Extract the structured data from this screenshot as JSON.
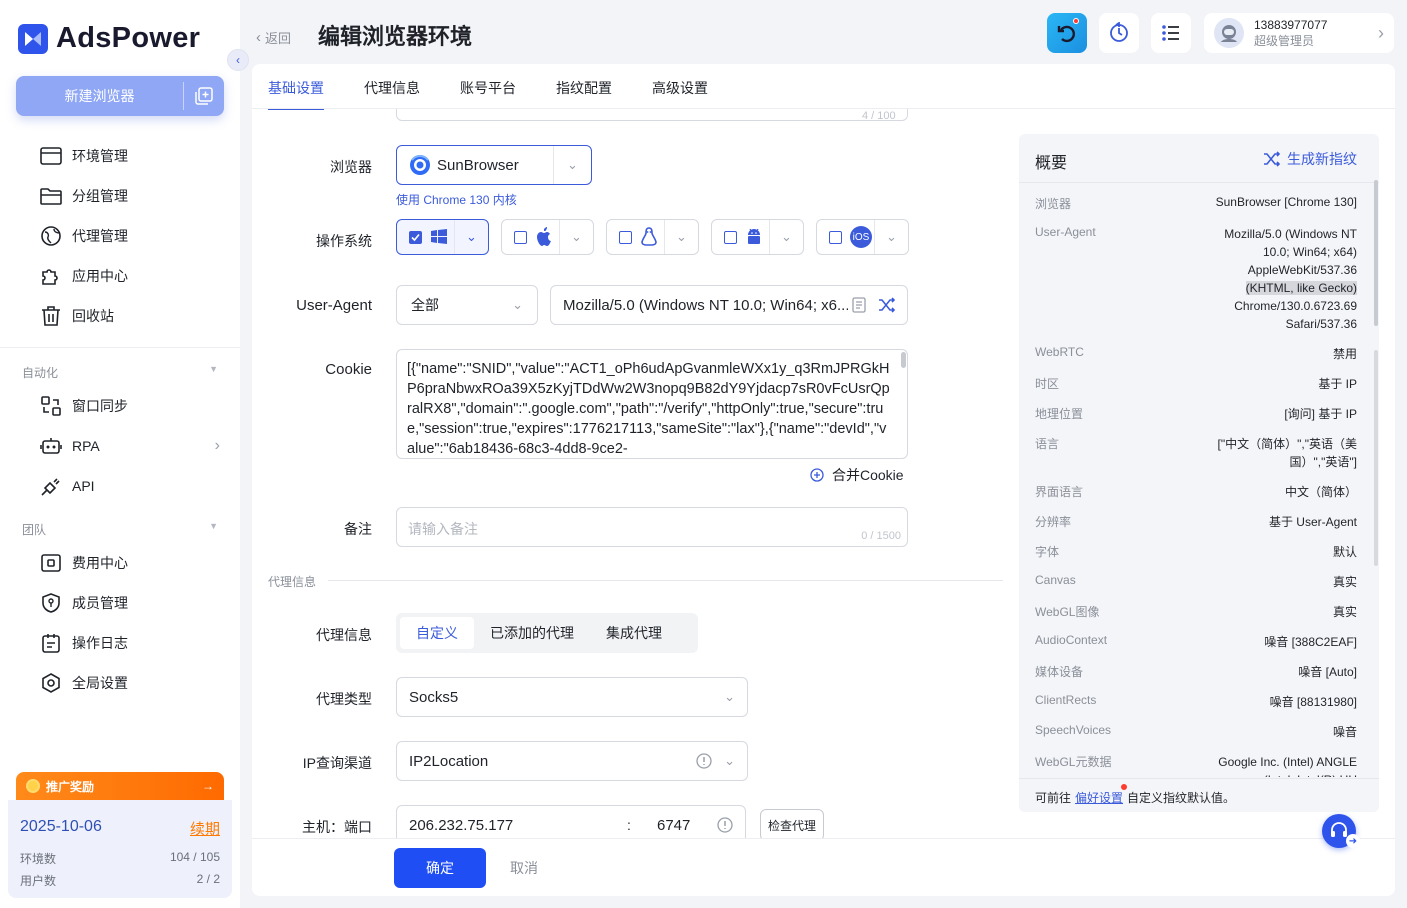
{
  "app": {
    "name": "AdsPower"
  },
  "sidebar": {
    "new_browser": "新建浏览器",
    "items": [
      {
        "label": "环境管理",
        "icon": "window-icon"
      },
      {
        "label": "分组管理",
        "icon": "folder-icon"
      },
      {
        "label": "代理管理",
        "icon": "proxy-icon"
      },
      {
        "label": "应用中心",
        "icon": "puzzle-icon"
      },
      {
        "label": "回收站",
        "icon": "trash-icon"
      }
    ],
    "automation_title": "自动化",
    "automation_items": [
      {
        "label": "窗口同步",
        "icon": "sync-window-icon"
      },
      {
        "label": "RPA",
        "icon": "robot-icon"
      },
      {
        "label": "API",
        "icon": "plug-icon"
      }
    ],
    "team_title": "团队",
    "team_items": [
      {
        "label": "费用中心",
        "icon": "billing-icon"
      },
      {
        "label": "成员管理",
        "icon": "shield-user-icon"
      },
      {
        "label": "操作日志",
        "icon": "log-icon"
      },
      {
        "label": "全局设置",
        "icon": "settings-icon"
      }
    ],
    "promo": {
      "label": "推广奖励",
      "arrow": "→"
    },
    "plan": {
      "expiry": "2025-10-06",
      "renew": "续期",
      "env_label": "环境数",
      "env_value": "104 / 105",
      "users_label": "用户数",
      "users_value": "2 / 2"
    }
  },
  "header": {
    "back": "返回",
    "title": "编辑浏览器环境",
    "user": {
      "phone": "13883977077",
      "role": "超级管理员"
    }
  },
  "tabs": [
    "基础设置",
    "代理信息",
    "账号平台",
    "指纹配置",
    "高级设置"
  ],
  "form": {
    "name_counter": "4 / 100",
    "browser_label": "浏览器",
    "browser_value": "SunBrowser",
    "browser_hint": "使用 Chrome 130 内核",
    "os_label": "操作系统",
    "os_options": [
      {
        "icon": "windows-icon",
        "checked": true
      },
      {
        "icon": "apple-icon",
        "checked": false
      },
      {
        "icon": "linux-icon",
        "checked": false
      },
      {
        "icon": "android-icon",
        "checked": false
      },
      {
        "icon": "ios-icon",
        "checked": false,
        "text": "iOS"
      }
    ],
    "ua_label": "User-Agent",
    "ua_filter": "全部",
    "ua_value": "Mozilla/5.0 (Windows NT 10.0; Win64; x6...",
    "cookie_label": "Cookie",
    "cookie_value": "[{\"name\":\"SNID\",\"value\":\"ACT1_oPh6udApGvanmleWXx1y_q3RmJPRGkHP6praNbwxROa39X5zKyjTDdWw2W3nopq9B82dY9Yjdacp7sR0vFcUsrQpralRX8\",\"domain\":\".google.com\",\"path\":\"/verify\",\"httpOnly\":true,\"secure\":true,\"session\":true,\"expires\":1776217113,\"sameSite\":\"lax\"},{\"name\":\"devId\",\"value\":\"6ab18436-68c3-4dd8-9ce2-",
    "merge_cookie": "合并Cookie",
    "note_label": "备注",
    "note_placeholder": "请输入备注",
    "note_counter": "0 / 1500",
    "proxy_section": "代理信息",
    "proxy_label": "代理信息",
    "proxy_modes": [
      "自定义",
      "已添加的代理",
      "集成代理"
    ],
    "proxy_type_label": "代理类型",
    "proxy_type": "Socks5",
    "ip_channel_label": "IP查询渠道",
    "ip_channel": "IP2Location",
    "host_label": "主机：端口",
    "host": "206.232.75.177",
    "port": "6747",
    "check_proxy": "检查代理",
    "ok": "确定",
    "cancel": "取消"
  },
  "summary": {
    "title": "概要",
    "generate": "生成新指纹",
    "rows": [
      {
        "k": "浏览器",
        "v": "SunBrowser [Chrome 130]"
      },
      {
        "k": "User-Agent",
        "v": "Mozilla/5.0 (Windows NT 10.0; Win64; x64) AppleWebKit/537.36 (KHTML, like Gecko) Chrome/130.0.6723.69 Safari/537.36"
      },
      {
        "k": "WebRTC",
        "v": "禁用"
      },
      {
        "k": "时区",
        "v": "基于 IP"
      },
      {
        "k": "地理位置",
        "v": "[询问] 基于 IP"
      },
      {
        "k": "语言",
        "v": "[\"中文（简体）\",\"英语（美国）\",\"英语\"]"
      },
      {
        "k": "界面语言",
        "v": "中文（简体）"
      },
      {
        "k": "分辨率",
        "v": "基于 User-Agent"
      },
      {
        "k": "字体",
        "v": "默认"
      },
      {
        "k": "Canvas",
        "v": "真实"
      },
      {
        "k": "WebGL图像",
        "v": "真实"
      },
      {
        "k": "AudioContext",
        "v": "噪音 [388C2EAF]"
      },
      {
        "k": "媒体设备",
        "v": "噪音 [Auto]"
      },
      {
        "k": "ClientRects",
        "v": "噪音 [88131980]"
      },
      {
        "k": "SpeechVoices",
        "v": "噪音"
      },
      {
        "k": "WebGL元数据",
        "v": "Google Inc. (Intel) ANGLE (Intel, Intel(R) UH"
      }
    ],
    "footer_prefix": "可前往",
    "footer_link": "偏好设置",
    "footer_suffix": "自定义指纹默认值。"
  },
  "colors": {
    "accent": "#3b5bdb",
    "primary": "#1f4ef5",
    "promo": "#ff7a00"
  }
}
